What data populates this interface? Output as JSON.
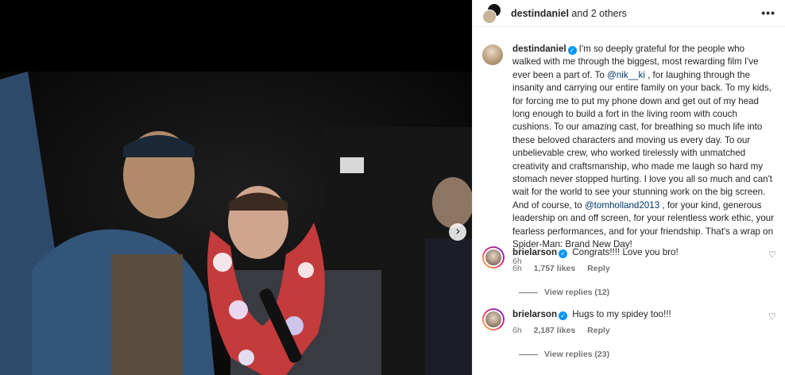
{
  "header": {
    "username": "destindaniel",
    "others": "and 2 others",
    "more_icon": "more-horizontal-icon"
  },
  "caption": {
    "username": "destindaniel",
    "text_part1": "I'm so deeply grateful for the people who walked with me through the biggest, most rewarding film I've ever been a part of. To ",
    "mention1": "@nik__ki",
    "text_part2": " , for laughing through the insanity and carrying our entire family on your back. To my kids, for forcing me to put my phone down and get out of my head long enough to build a fort in the living room with couch cushions. To our amazing cast, for breathing so much life into these beloved characters and moving us every day. To our unbelievable crew, who worked tirelessly with unmatched creativity and craftsmanship, who made me laugh so hard my stomach never stopped hurting. I love you all so much and can't wait for the world to see your stunning work on the big screen. And of course, to ",
    "mention2": "@tomholland2013",
    "text_part3": " , for your kind, generous leadership on and off screen, for your relentless work ethic, your fearless performances, and for your friendship. That's a wrap on Spider-Man: Brand New Day!",
    "time": "6h"
  },
  "comments": [
    {
      "username": "brielarson",
      "text": "Congrats!!!! Love you bro!",
      "time": "6h",
      "likes": "1,757 likes",
      "reply": "Reply",
      "view_replies": "View replies (12)"
    },
    {
      "username": "brielarson",
      "text": "Hugs to my spidey too!!!",
      "time": "6h",
      "likes": "2,187 likes",
      "reply": "Reply",
      "view_replies": "View replies (23)"
    }
  ],
  "colors": {
    "accent_blue": "#0095f6",
    "mention": "#00376b",
    "muted": "#737373"
  }
}
